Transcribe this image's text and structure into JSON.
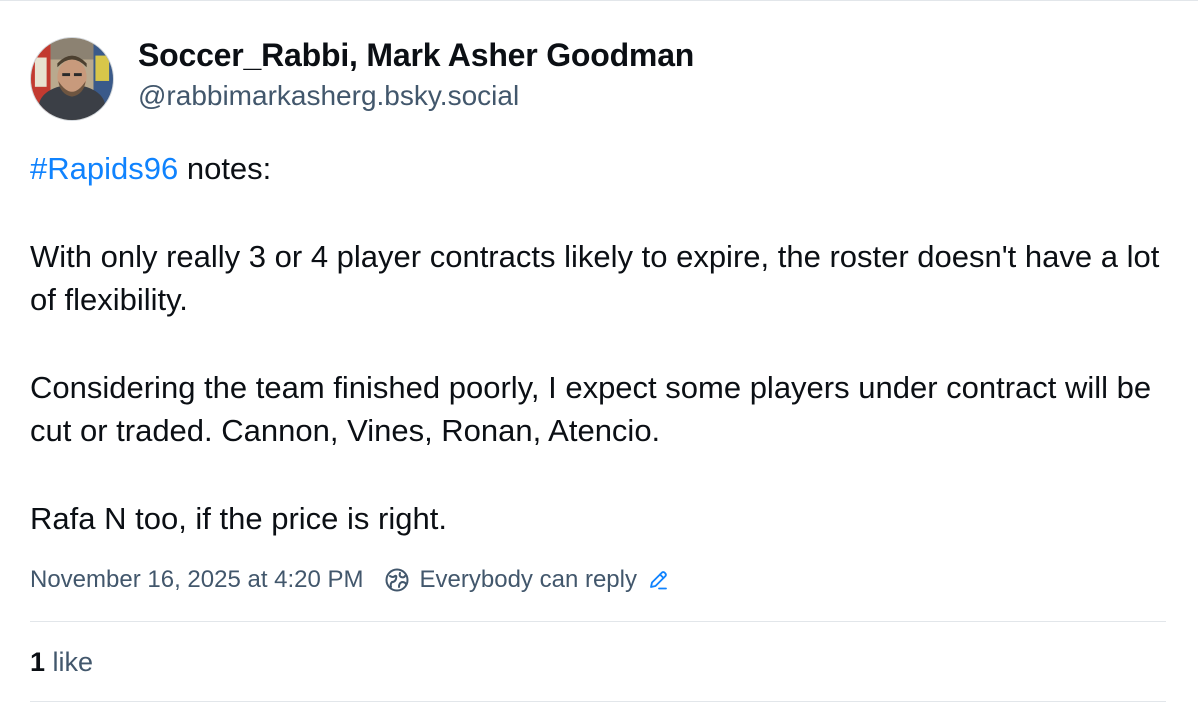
{
  "author": {
    "display_name": "Soccer_Rabbi, Mark Asher Goodman",
    "handle": "@rabbimarkasherg.bsky.social"
  },
  "post": {
    "hashtag": "#Rapids96",
    "first_line_rest": " notes:",
    "paragraph_1": "With only really 3 or 4 player contracts likely to expire, the roster doesn't have a lot of flexibility.",
    "paragraph_2": "Considering the team finished poorly, I expect some players under contract will be cut or traded. Cannon, Vines, Ronan, Atencio.",
    "paragraph_3": "Rafa N too, if the price is right."
  },
  "meta": {
    "timestamp": "November 16, 2025 at 4:20 PM",
    "reply_setting": "Everybody can reply",
    "globe_icon": "globe-icon",
    "edit_icon": "pencil-icon"
  },
  "engagement": {
    "likes_count": "1",
    "likes_label": " like"
  },
  "colors": {
    "link": "#1083fe",
    "muted": "#42576c",
    "text": "#0b0f14",
    "divider": "#e2e6ea"
  }
}
